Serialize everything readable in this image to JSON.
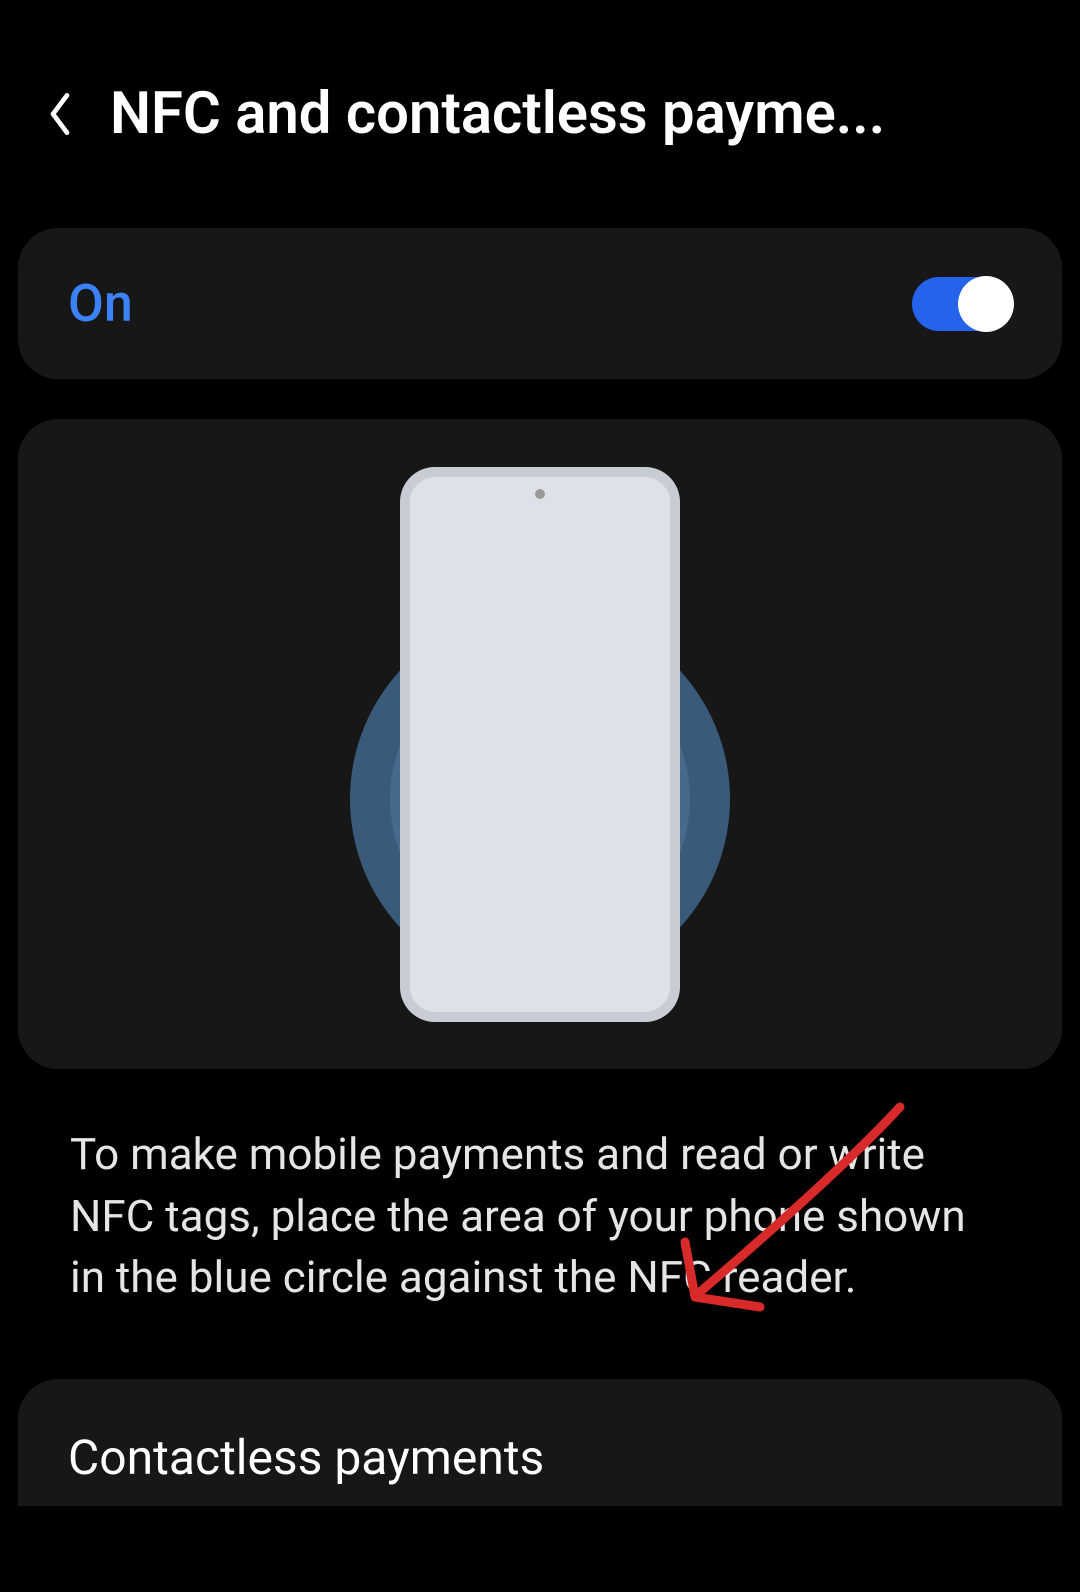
{
  "header": {
    "title": "NFC and contactless payme..."
  },
  "toggle": {
    "label": "On",
    "state": true
  },
  "description": "To make mobile payments and read or write NFC tags, place the area of your phone shown in the blue circle against the NFC reader.",
  "bottom_item": {
    "label": "Contactless payments"
  },
  "colors": {
    "accent": "#3b82f6",
    "annotation": "#d92a2a"
  }
}
